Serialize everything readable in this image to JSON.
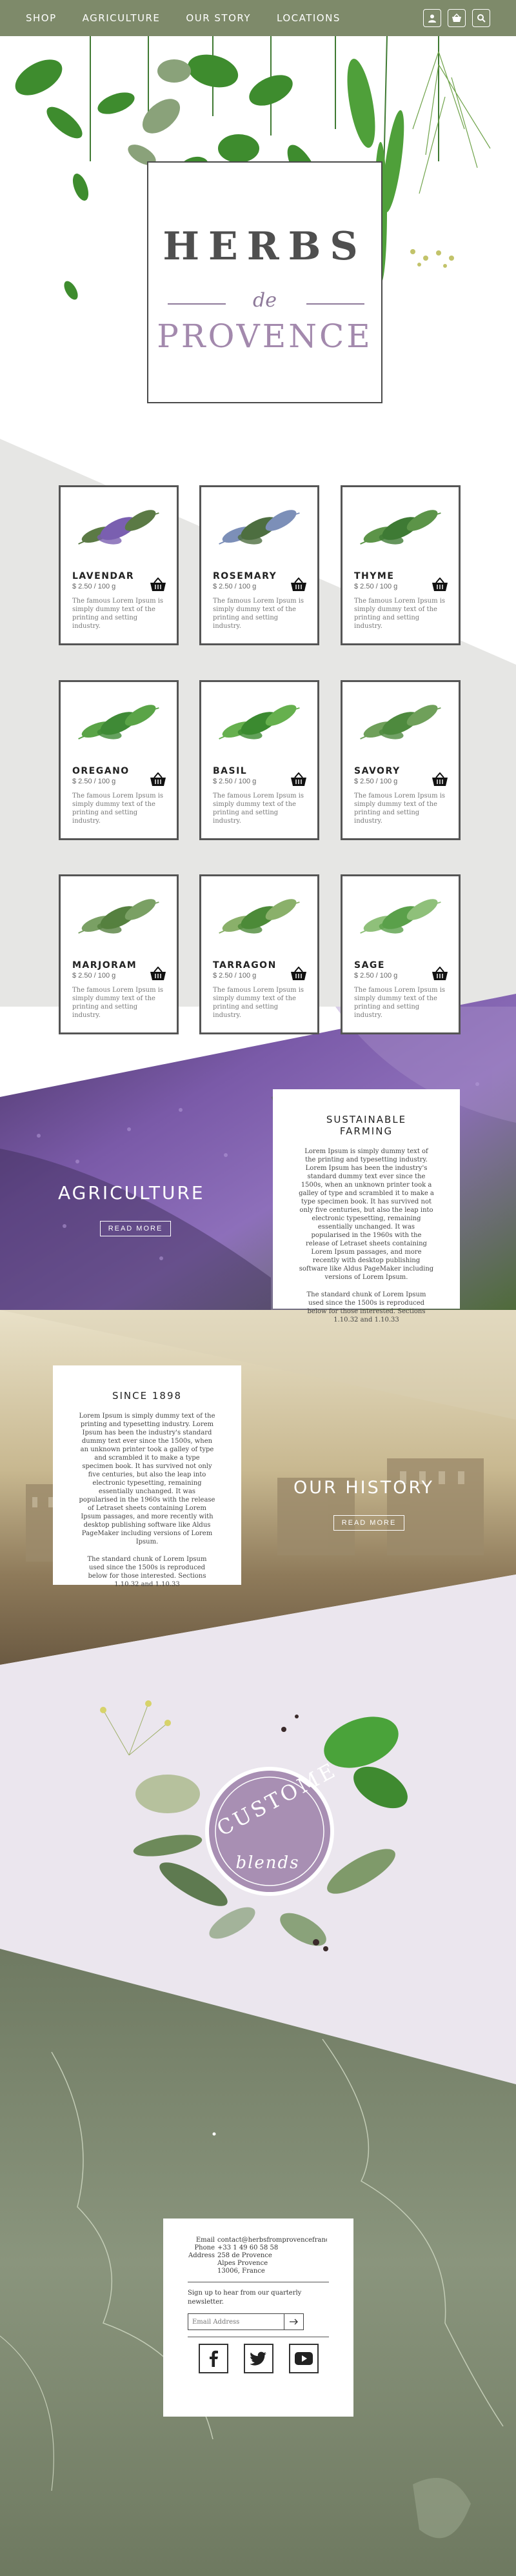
{
  "nav": {
    "links": [
      "SHOP",
      "AGRICULTURE",
      "OUR STORY",
      "LOCATIONS"
    ],
    "icons": [
      "user-icon",
      "basket-icon",
      "search-icon"
    ]
  },
  "hero": {
    "logo_line1": "HERBS",
    "logo_line2": "de",
    "logo_line3": "PROVENCE"
  },
  "products": [
    {
      "name": "LAVENDAR",
      "price": "$ 2.50 / 100 g",
      "desc": "The famous Lorem Ipsum is simply dummy text of the printing and setting industry."
    },
    {
      "name": "ROSEMARY",
      "price": "$ 2.50 / 100 g",
      "desc": "The famous Lorem Ipsum is simply dummy text of the printing and setting industry."
    },
    {
      "name": "THYME",
      "price": "$ 2.50 / 100 g",
      "desc": "The famous Lorem Ipsum is simply dummy text of the printing and setting industry."
    },
    {
      "name": "OREGANO",
      "price": "$ 2.50 / 100 g",
      "desc": "The famous Lorem Ipsum is simply dummy text of the printing and setting industry."
    },
    {
      "name": "BASIL",
      "price": "$ 2.50 / 100 g",
      "desc": "The famous Lorem Ipsum is simply dummy text of the printing and setting industry."
    },
    {
      "name": "SAVORY",
      "price": "$ 2.50 / 100 g",
      "desc": "The famous Lorem Ipsum is simply dummy text of the printing and setting industry."
    },
    {
      "name": "MARJORAM",
      "price": "$ 2.50 / 100 g",
      "desc": "The famous Lorem Ipsum is simply dummy text of the printing and setting industry."
    },
    {
      "name": "TARRAGON",
      "price": "$ 2.50 / 100 g",
      "desc": "The famous Lorem Ipsum is simply dummy text of the printing and setting industry."
    },
    {
      "name": "SAGE",
      "price": "$ 2.50 / 100 g",
      "desc": "The famous Lorem Ipsum is simply dummy text of the printing and setting industry."
    }
  ],
  "agriculture": {
    "title": "AGRICULTURE",
    "button": "READ MORE",
    "box_title": "SUSTAINABLE FARMING",
    "box_p1": "Lorem Ipsum is simply dummy text of the printing and typesetting industry. Lorem Ipsum has been the industry's standard dummy text ever since the 1500s, when an unknown printer took a galley of type and scrambled it to make a type specimen book. It has survived not only five centuries, but also the leap into electronic typesetting, remaining essentially unchanged. It was popularised in the 1960s with the release of Letraset sheets containing Lorem Ipsum passages, and more recently with desktop publishing software like Aldus PageMaker including versions of Lorem Ipsum.",
    "box_p2": "The standard chunk of Lorem Ipsum used since the 1500s is reproduced below for those interested. Sections 1.10.32 and 1.10.33"
  },
  "history": {
    "title": "OUR HISTORY",
    "button": "READ MORE",
    "box_title": "SINCE 1898",
    "box_p1": "Lorem Ipsum is simply dummy text of the printing and typesetting industry. Lorem Ipsum has been the industry's standard dummy text ever since the 1500s, when an unknown printer took a galley of type and scrambled it to make a type specimen book. It has survived not only five centuries, but also the leap into electronic typesetting, remaining essentially unchanged. It was popularised in the 1960s with the release of Letraset sheets containing Lorem Ipsum passages, and more recently with desktop publishing software like Aldus PageMaker including versions of Lorem Ipsum.",
    "box_p2": "The standard chunk of Lorem Ipsum used since the 1500s is reproduced below for those interested. Sections 1.10.32 and 1.10.33"
  },
  "blends": {
    "line1": "CUSTOME",
    "line2": "blends"
  },
  "contact": {
    "email_label": "Email",
    "email_value": "contact@herbsfromprovencefrance.com",
    "phone_label": "Phone",
    "phone_value": "+33 1 49 60 58 58",
    "address_label": "Address",
    "address_line1": "258 de Provence",
    "address_line2": "Alpes Provence",
    "address_line3": "13006, France",
    "signup_text": "Sign up to hear from our quarterly newsletter.",
    "email_placeholder": "Email Address",
    "socials": [
      "facebook-icon",
      "twitter-icon",
      "youtube-icon"
    ]
  },
  "colors": {
    "nav": "#7e8a6a",
    "accent_purple": "#a389ad",
    "map_green": "#7b8670"
  }
}
